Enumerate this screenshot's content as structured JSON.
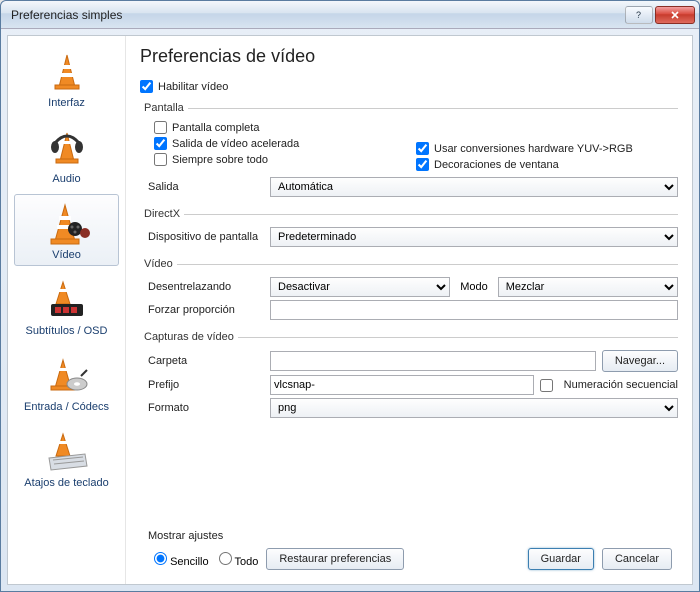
{
  "window": {
    "title": "Preferencias simples"
  },
  "sidebar": {
    "items": [
      {
        "label": "Interfaz"
      },
      {
        "label": "Audio"
      },
      {
        "label": "Vídeo"
      },
      {
        "label": "Subtítulos / OSD"
      },
      {
        "label": "Entrada / Códecs"
      },
      {
        "label": "Atajos de teclado"
      }
    ]
  },
  "page": {
    "title": "Preferencias de vídeo",
    "enable_video": "Habilitar vídeo",
    "screen": {
      "legend": "Pantalla",
      "fullscreen": "Pantalla completa",
      "accel_output": "Salida de vídeo acelerada",
      "always_on_top": "Siempre sobre todo",
      "yuv_rgb": "Usar conversiones hardware YUV->RGB",
      "window_deco": "Decoraciones de ventana",
      "output_label": "Salida",
      "output_value": "Automática"
    },
    "directx": {
      "legend": "DirectX",
      "device_label": "Dispositivo de pantalla",
      "device_value": "Predeterminado"
    },
    "video": {
      "legend": "Vídeo",
      "deint_label": "Desentrelazando",
      "deint_value": "Desactivar",
      "mode_label": "Modo",
      "mode_value": "Mezclar",
      "aspect_label": "Forzar proporción",
      "aspect_value": ""
    },
    "captures": {
      "legend": "Capturas de vídeo",
      "folder_label": "Carpeta",
      "folder_value": "",
      "browse": "Navegar...",
      "prefix_label": "Prefijo",
      "prefix_value": "vlcsnap-",
      "seq_num": "Numeración secuencial",
      "format_label": "Formato",
      "format_value": "png"
    }
  },
  "footer": {
    "show_settings": "Mostrar ajustes",
    "simple": "Sencillo",
    "all": "Todo",
    "reset": "Restaurar preferencias",
    "save": "Guardar",
    "cancel": "Cancelar"
  }
}
